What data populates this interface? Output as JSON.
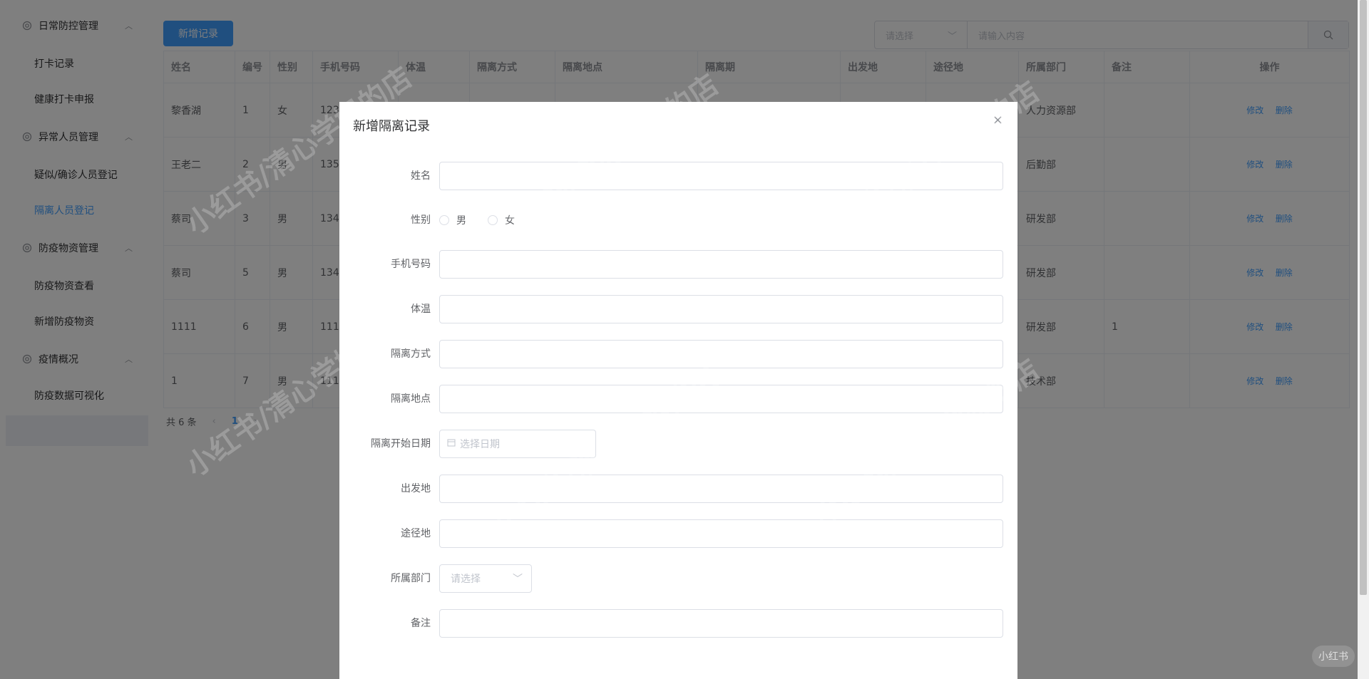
{
  "sidebar": {
    "groups": [
      {
        "title": "日常防控管理",
        "items": [
          "打卡记录",
          "健康打卡申报"
        ]
      },
      {
        "title": "异常人员管理",
        "items": [
          "疑似/确诊人员登记",
          "隔离人员登记"
        ]
      },
      {
        "title": "防疫物资管理",
        "items": [
          "防疫物资查看",
          "新增防疫物资"
        ]
      },
      {
        "title": "疫情概况",
        "items": [
          "防疫数据可视化"
        ]
      }
    ],
    "active_item": "隔离人员登记"
  },
  "toolbar": {
    "add_label": "新增记录",
    "search_select_placeholder": "请选择",
    "search_input_placeholder": "请输入内容"
  },
  "table": {
    "headers": [
      "姓名",
      "编号",
      "性别",
      "手机号码",
      "体温",
      "隔离方式",
      "隔离地点",
      "隔离期",
      "出发地",
      "途径地",
      "所属部门",
      "备注",
      "操作"
    ],
    "rows": [
      [
        "黎香湖",
        "1",
        "女",
        "1234",
        "",
        "",
        "",
        "",
        "",
        "",
        "人力资源部",
        ""
      ],
      [
        "王老二",
        "2",
        "男",
        "1354",
        "",
        "",
        "",
        "",
        "",
        "",
        "后勤部",
        ""
      ],
      [
        "蔡司",
        "3",
        "男",
        "1345",
        "",
        "",
        "",
        "",
        "",
        "",
        "研发部",
        ""
      ],
      [
        "蔡司",
        "5",
        "男",
        "1345",
        "",
        "",
        "",
        "",
        "",
        "",
        "研发部",
        ""
      ],
      [
        "1111",
        "6",
        "男",
        "1111",
        "",
        "",
        "",
        "",
        "",
        "",
        "研发部",
        "1"
      ],
      [
        "1",
        "7",
        "男",
        "111",
        "",
        "",
        "",
        "",
        "",
        "",
        "技术部",
        ""
      ]
    ],
    "edit_label": "修改",
    "delete_label": "删除"
  },
  "pagination": {
    "total": "共 6 条",
    "current_page": "1"
  },
  "dialog": {
    "title": "新增隔离记录",
    "fields": {
      "name": "姓名",
      "gender": "性别",
      "gender_male": "男",
      "gender_female": "女",
      "phone": "手机号码",
      "temperature": "体温",
      "method": "隔离方式",
      "location": "隔离地点",
      "start_date": "隔离开始日期",
      "start_date_placeholder": "选择日期",
      "departure": "出发地",
      "route": "途径地",
      "department": "所属部门",
      "department_placeholder": "请选择",
      "remark": "备注"
    }
  },
  "watermark": "小红书/清心学姐的店",
  "corner_badge": "小红书",
  "colors": {
    "primary": "#409eff",
    "overlay": "rgba(0,0,0,0.5)"
  }
}
